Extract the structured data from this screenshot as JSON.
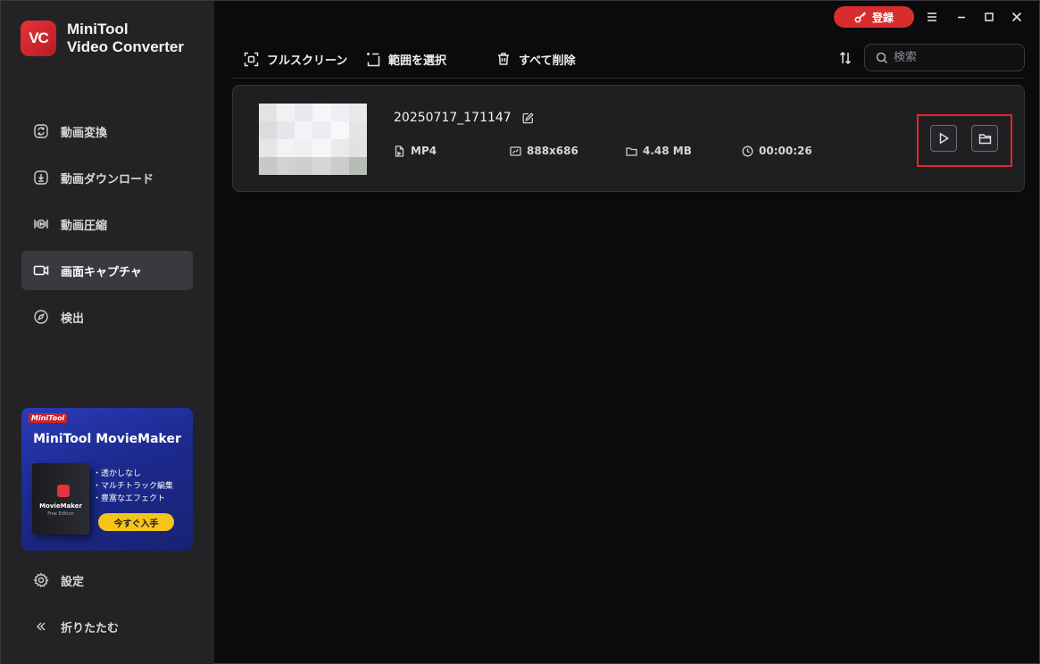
{
  "app": {
    "title_line1": "MiniTool",
    "title_line2": "Video Converter",
    "logo_text": "VC"
  },
  "titlebar": {
    "register_label": "登録"
  },
  "sidebar": {
    "items": [
      {
        "label": "動画変換",
        "icon": "convert-icon"
      },
      {
        "label": "動画ダウンロード",
        "icon": "download-icon"
      },
      {
        "label": "動画圧縮",
        "icon": "compress-icon"
      },
      {
        "label": "画面キャプチャ",
        "icon": "camera-icon",
        "active": true
      },
      {
        "label": "検出",
        "icon": "compass-icon"
      }
    ],
    "settings_label": "設定",
    "collapse_label": "折りたたむ"
  },
  "ad": {
    "brand": "MiniTool",
    "title": "MiniTool MovieMaker",
    "box_name": "MovieMaker",
    "box_sub": "Free Edition",
    "features": [
      "・透かしなし",
      "・マルチトラック編集",
      "・豊富なエフェクト"
    ],
    "cta": "今すぐ入手"
  },
  "toolbar": {
    "fullscreen_label": "フルスクリーン",
    "select_area_label": "範囲を選択",
    "delete_all_label": "すべて削除",
    "search_placeholder": "検索"
  },
  "files": [
    {
      "name": "20250717_171147",
      "format": "MP4",
      "resolution": "888x686",
      "size": "4.48 MB",
      "duration": "00:00:26"
    }
  ],
  "colors": {
    "accent_red": "#d72d2f",
    "highlight_red": "#e3262a",
    "sidebar_bg": "#232326",
    "main_bg": "#0b0b0d"
  }
}
